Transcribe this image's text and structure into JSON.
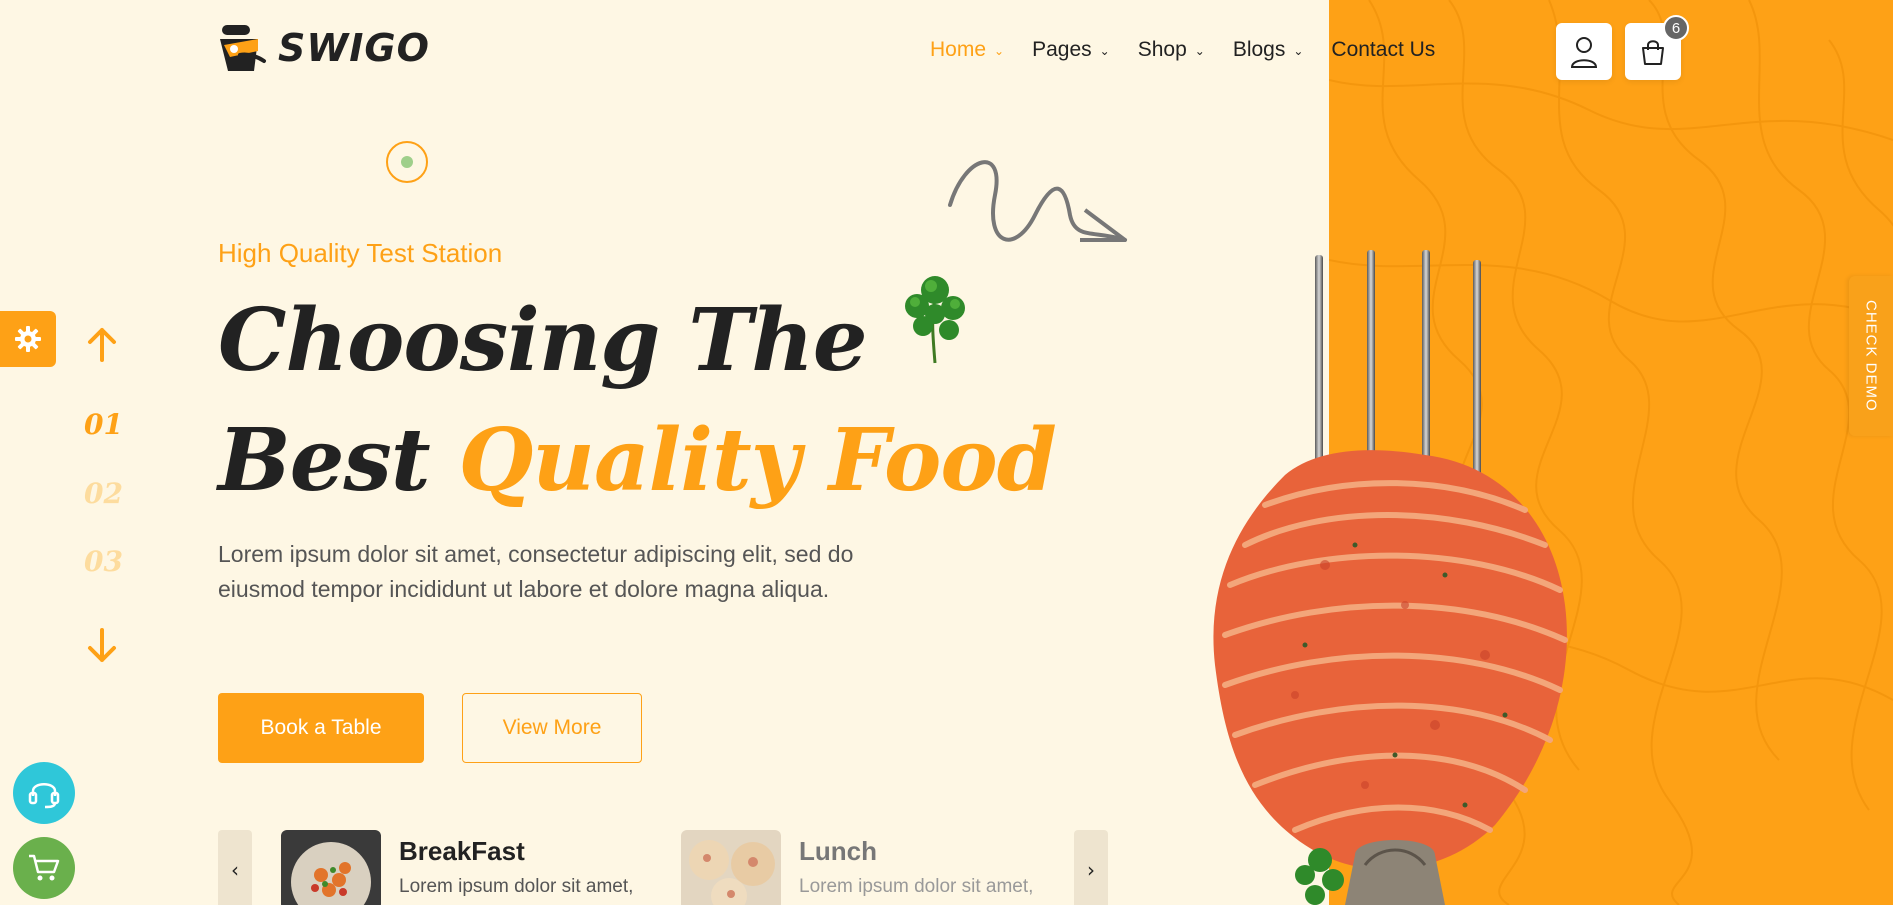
{
  "brand": {
    "name": "SWIGO"
  },
  "nav": {
    "items": [
      {
        "label": "Home",
        "has_dropdown": true,
        "active": true
      },
      {
        "label": "Pages",
        "has_dropdown": true,
        "active": false
      },
      {
        "label": "Shop",
        "has_dropdown": true,
        "active": false
      },
      {
        "label": "Blogs",
        "has_dropdown": true,
        "active": false
      },
      {
        "label": "Contact Us",
        "has_dropdown": false,
        "active": false
      }
    ]
  },
  "header_actions": {
    "user_icon": "user-icon",
    "cart_icon": "bag-icon",
    "cart_count": "6"
  },
  "hero": {
    "subtitle": "High Quality Test Station",
    "headline_line1": "Choosing The",
    "headline_line2_plain": "Best",
    "headline_line2_highlight": "Quality Food",
    "description": "Lorem ipsum dolor sit amet, consectetur adipiscing elit, sed do eiusmod tempor incididunt ut labore et dolore magna aliqua.",
    "primary_button": "Book a Table",
    "secondary_button": "View More"
  },
  "slider": {
    "numbers": [
      "01",
      "02",
      "03"
    ],
    "active_index": 0
  },
  "side_tabs": {
    "check_demo": "CHECK DEMO"
  },
  "menu_cards": [
    {
      "title": "BreakFast",
      "description": "Lorem ipsum dolor sit amet,"
    },
    {
      "title": "Lunch",
      "description": "Lorem ipsum dolor sit amet,"
    }
  ],
  "colors": {
    "accent": "#fea116",
    "background": "#fef7e4",
    "text": "#222222",
    "support": "#2fc7d9",
    "cart_float": "#6ab04c"
  }
}
